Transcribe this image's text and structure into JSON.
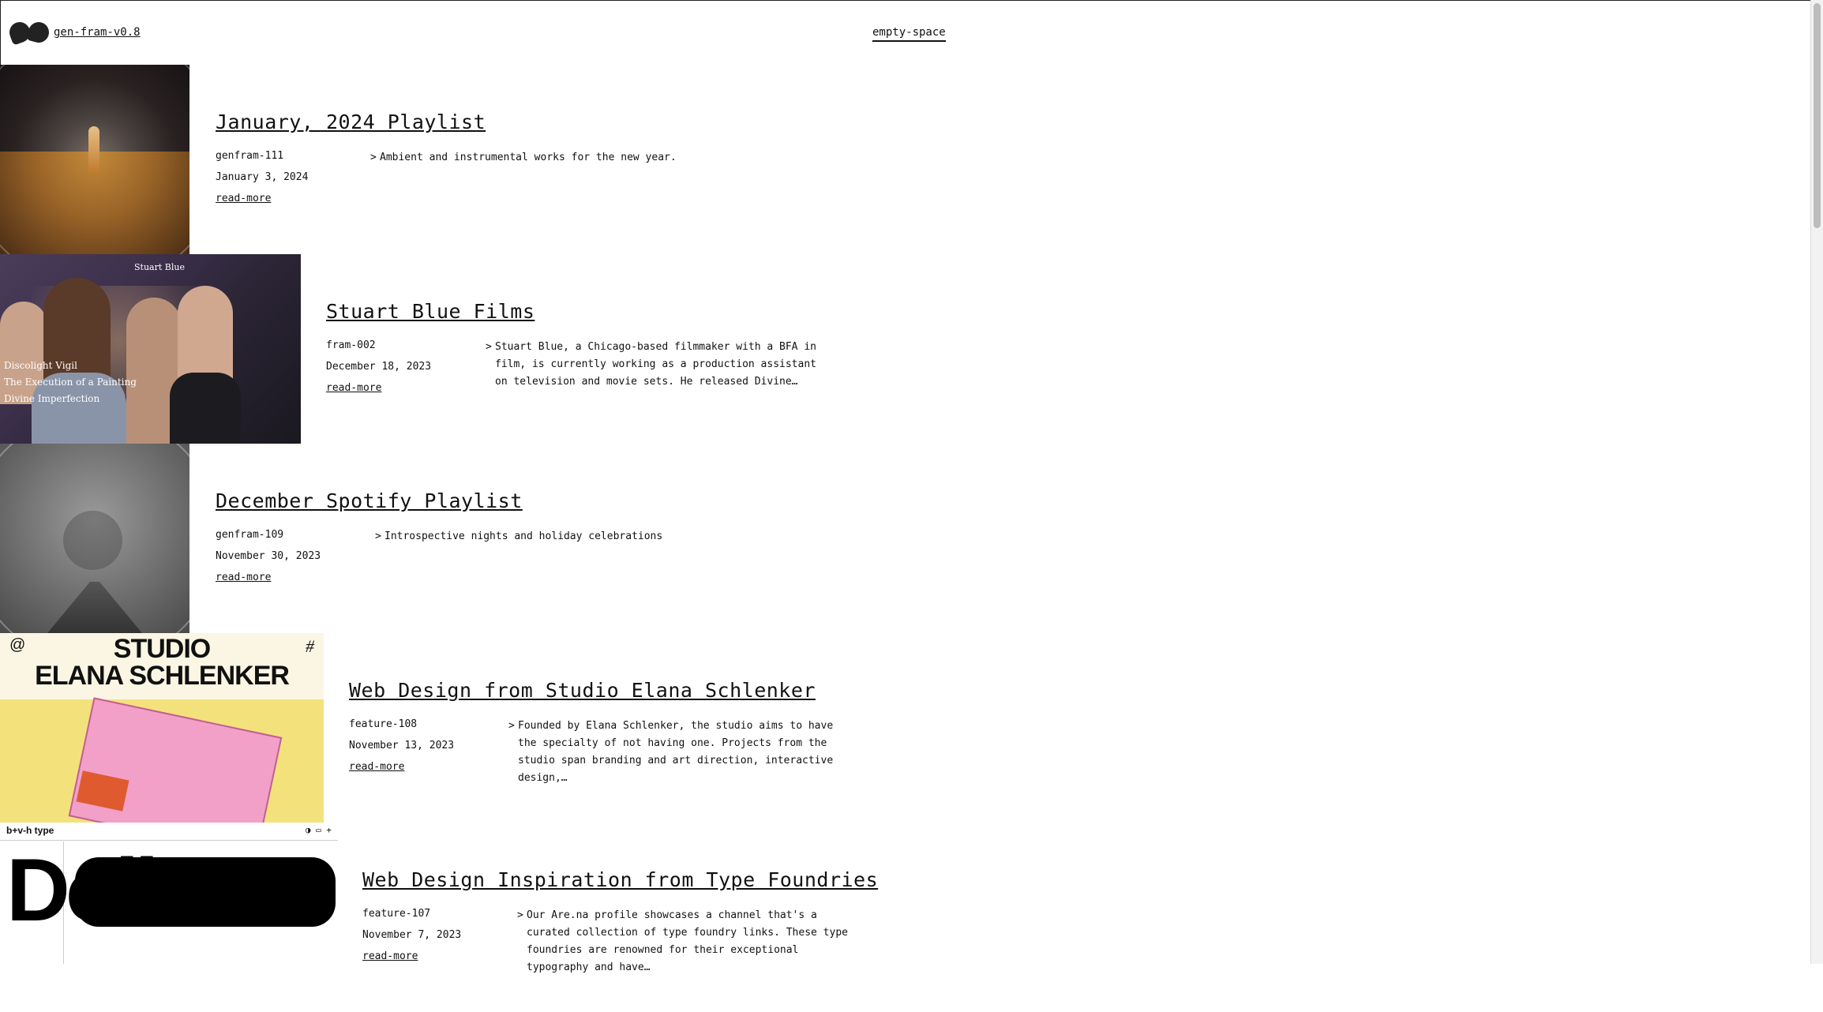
{
  "header": {
    "site_name": "gen-fram-v0.8",
    "nav_link": "empty-space"
  },
  "entries": [
    {
      "title": "January, 2024 Playlist",
      "id": "genfram-111",
      "date": "January 3, 2024",
      "read_more": "read-more",
      "description": "Ambient and instrumental works for the new year."
    },
    {
      "title": "Stuart Blue Films",
      "id": "fram-002",
      "date": "December 18, 2023",
      "read_more": "read-more",
      "description": "Stuart Blue, a Chicago-based filmmaker with a BFA in film, is currently working as a production assistant on television and movie sets. He released Divine…",
      "thumb_text": {
        "brand": "Stuart Blue",
        "line1": "Discolight Vigil",
        "line2": "The Execution of a Painting",
        "line3": "Divine Imperfection"
      }
    },
    {
      "title": "December Spotify Playlist",
      "id": "genfram-109",
      "date": "November 30, 2023",
      "read_more": "read-more",
      "description": "Introspective nights and holiday celebrations"
    },
    {
      "title": "Web Design from Studio Elana Schlenker",
      "id": "feature-108",
      "date": "November 13, 2023",
      "read_more": "read-more",
      "description": "Founded by Elana Schlenker, the studio aims to have the specialty of not having one. Projects from the studio span branding and art direction, interactive design,…",
      "thumb_text": {
        "line1": "STUDIO",
        "line2": "ELANA SCHLENKER",
        "at": "@",
        "hash": "#"
      }
    },
    {
      "title": "Web Design Inspiration from Type Foundries",
      "id": "feature-107",
      "date": "November 7, 2023",
      "read_more": "read-more",
      "description": "Our Are.na profile showcases a channel that's a curated collection of type foundry links. These type foundries are renowned for their exceptional typography and have…",
      "thumb_text": {
        "brand": "b+v-h type",
        "big": "Dolina"
      }
    }
  ]
}
